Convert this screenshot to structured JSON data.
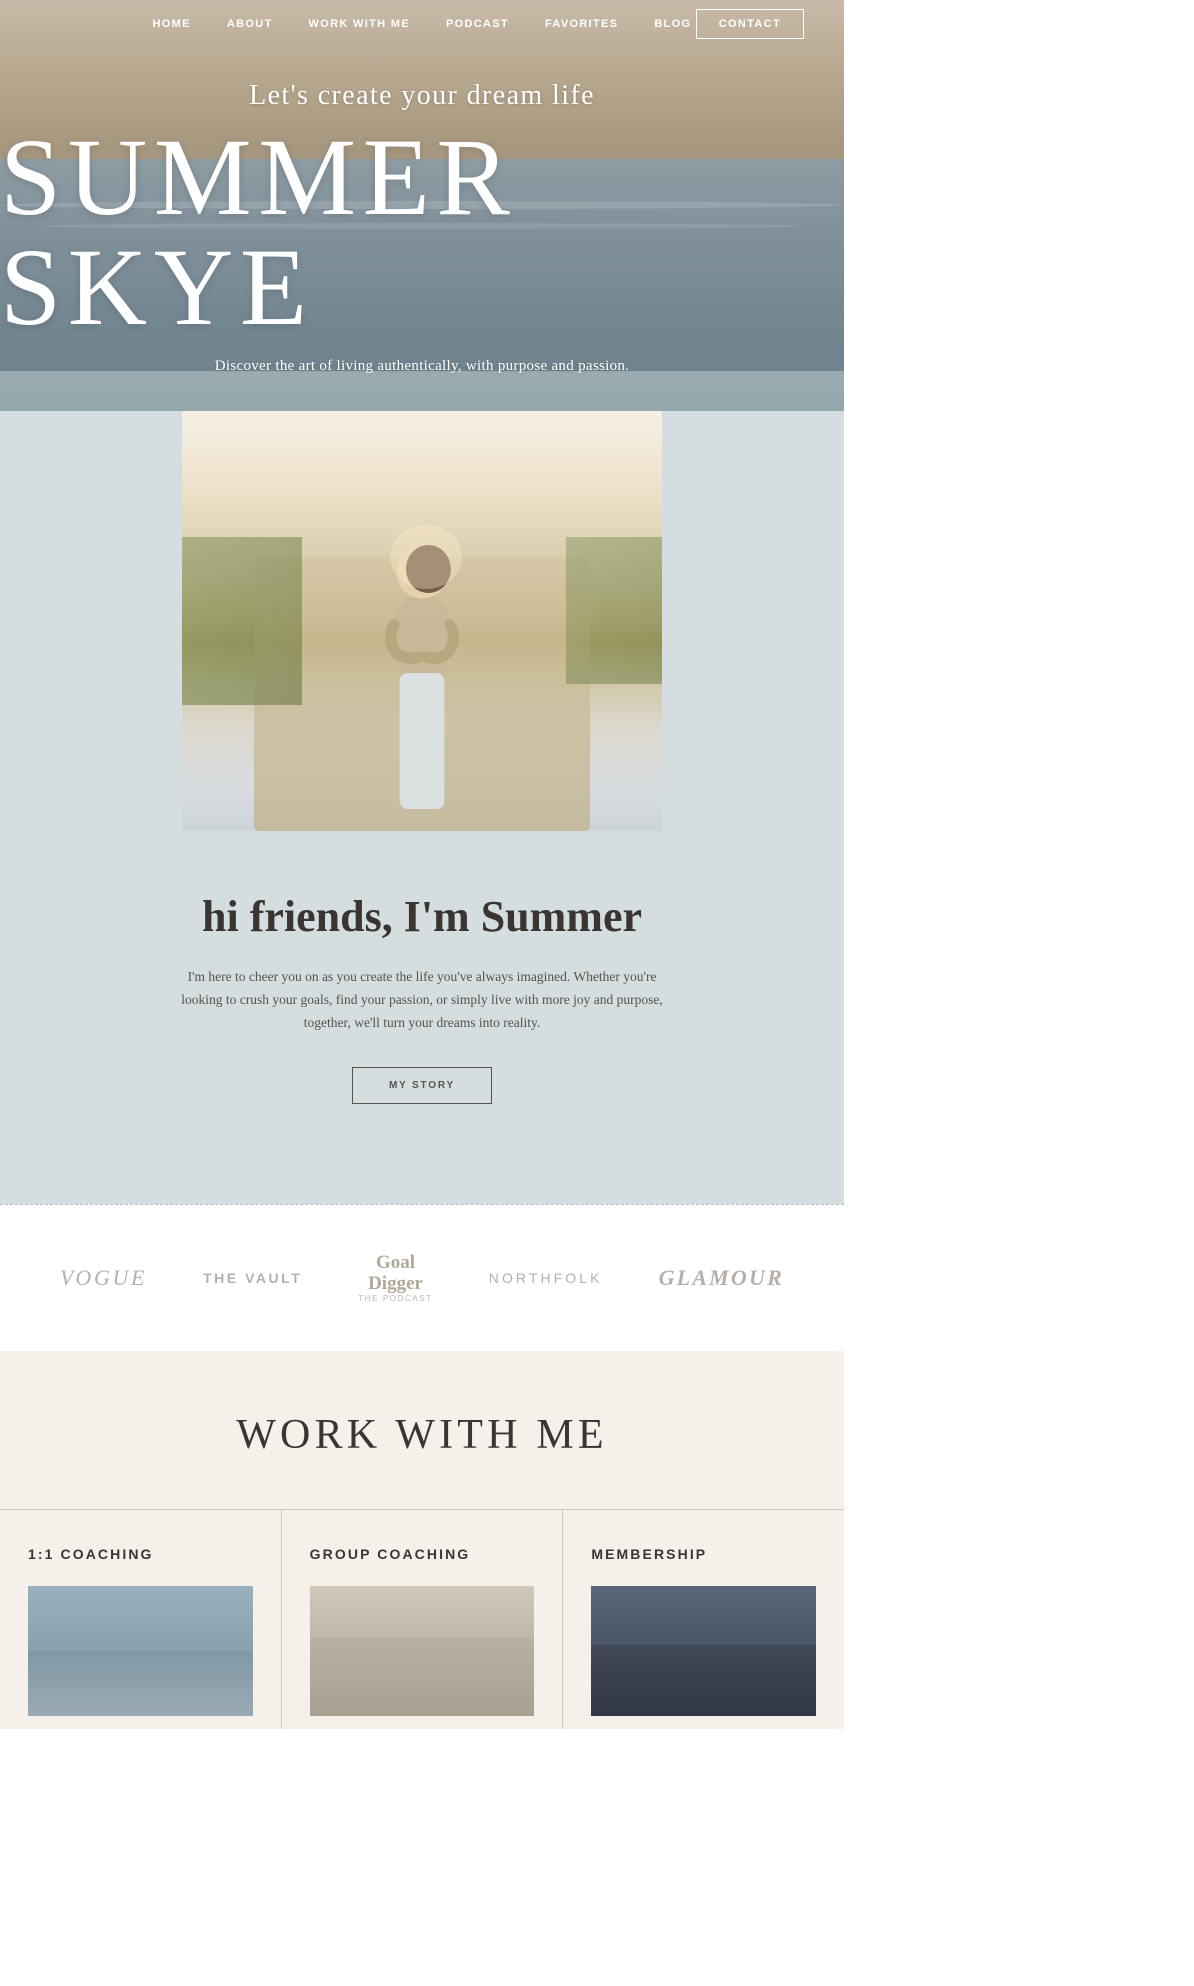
{
  "nav": {
    "links": [
      {
        "label": "HOME",
        "id": "home"
      },
      {
        "label": "ABOUT",
        "id": "about"
      },
      {
        "label": "WORK WITH ME",
        "id": "work-with-me"
      },
      {
        "label": "PODCAST",
        "id": "podcast"
      },
      {
        "label": "FAVORITES",
        "id": "favorites"
      },
      {
        "label": "BLOG",
        "id": "blog"
      }
    ],
    "contact_label": "CONTACT"
  },
  "hero": {
    "subtitle": "Let's create your dream life",
    "title": "SUMMER SKYE",
    "description": "Discover the art of living authentically, with purpose and passion."
  },
  "intro": {
    "heading": "hi friends, I'm Summer",
    "text": "I'm here to cheer you on as you create the life you've always imagined. Whether you're looking to crush your goals, find your passion, or simply live with more joy and purpose, together, we'll turn your dreams into reality.",
    "button_label": "MY STORY"
  },
  "press": {
    "logos": [
      {
        "label": "VOGUE",
        "style": "sans"
      },
      {
        "label": "THE VAULT",
        "style": "sans"
      },
      {
        "label": "Goal\nDigger",
        "sub": "THE PODCAST",
        "style": "script"
      },
      {
        "label": "NORTHFOLK",
        "style": "sans"
      },
      {
        "label": "GLAMOUR",
        "style": "serif"
      }
    ]
  },
  "work": {
    "title": "WORK WITH ME",
    "cards": [
      {
        "title": "1:1 COACHING"
      },
      {
        "title": "GROUP COACHING"
      },
      {
        "title": "MEMBERSHIP"
      }
    ]
  }
}
